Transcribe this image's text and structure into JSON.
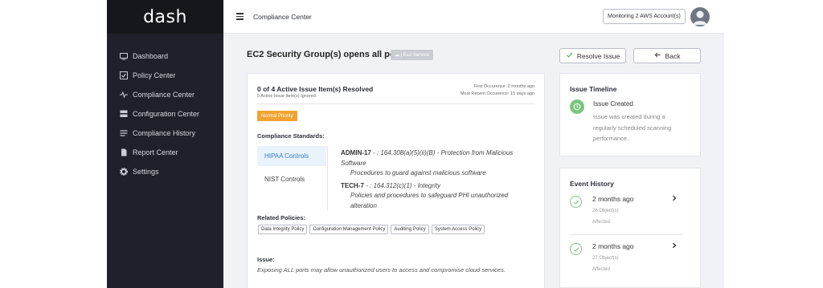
{
  "app": {
    "logo": "dash"
  },
  "sidebar": {
    "items": [
      {
        "label": "Dashboard",
        "icon": "monitor-icon"
      },
      {
        "label": "Policy Center",
        "icon": "checkbox-icon"
      },
      {
        "label": "Compliance Center",
        "icon": "pulse-icon"
      },
      {
        "label": "Configuration Center",
        "icon": "server-icon"
      },
      {
        "label": "Compliance History",
        "icon": "list-icon"
      },
      {
        "label": "Report Center",
        "icon": "document-icon"
      },
      {
        "label": "Settings",
        "icon": "gear-icon"
      }
    ]
  },
  "header": {
    "title": "Compliance Center",
    "account_button": "Monitoring 2 AWS Account(s)"
  },
  "page": {
    "title": "EC2 Security Group(s) opens all ports",
    "service_badge": "☁ | Ec2 Service",
    "resolve_button": "Resolve Issue",
    "back_button": "Back"
  },
  "issue_card": {
    "resolved_summary": "0 of 4 Active Issue Item(s) Resolved",
    "ignored_summary": "0 Active Issue Item(s) Ignored",
    "first_occurrence": "First Occurence: 2 months ago",
    "recent_occurrence": "Most Recent Occurence: 15 days ago",
    "priority": "Normal Priority",
    "standards_label": "Compliance Standards:",
    "standard_tabs": [
      "HIPAA Controls",
      "NIST Controls"
    ],
    "standards": [
      {
        "id": "ADMIN-17",
        "ref": " - : 164.308(a)(5)(ii)(B) - Protection from Malicious Software",
        "desc": "Procedures to guard against malicious software"
      },
      {
        "id": "TECH-7",
        "ref": " - : 164.312(c)(1) - Integrity",
        "desc": "Policies and procedures to safeguard PHI unauthorized alteration"
      }
    ],
    "related_label": "Related Policies:",
    "related_policies": [
      "Data Integrity Policy",
      "Configuration Management Policy",
      "Auditing Policy",
      "System Access Policy"
    ],
    "issue_label": "Issue:",
    "issue_text": "Exposing ALL ports may allow unauthorized users to access and compromise cloud services."
  },
  "timeline": {
    "title": "Issue Timeline",
    "event_title": "Issue Created",
    "event_text": "Issue was created during a regularly scheduled scanning performance."
  },
  "events": {
    "title": "Event History",
    "items": [
      {
        "when": "2 months ago",
        "objects": "26 Object(s)",
        "status": "Affected"
      },
      {
        "when": "2 months ago",
        "objects": "27 Object(s)",
        "status": "Affected"
      }
    ]
  },
  "colors": {
    "sidebar_bg": "#1e2129",
    "accent_blue": "#2f7fc4",
    "priority_orange": "#f0a330",
    "success_green": "#7bc67e"
  }
}
